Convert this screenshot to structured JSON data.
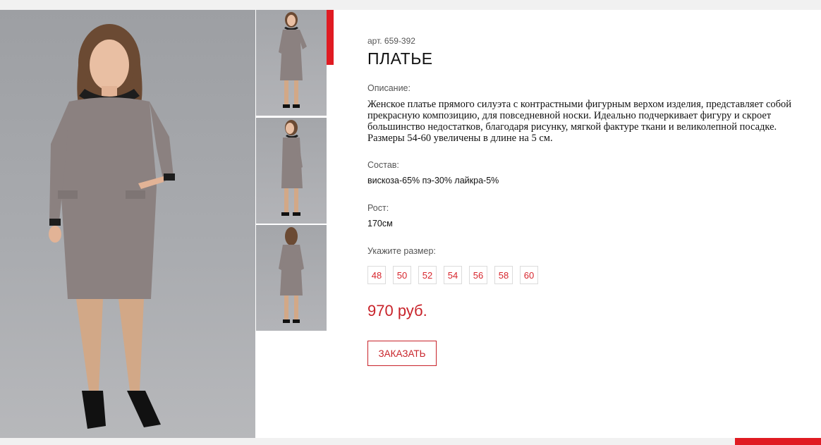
{
  "product": {
    "article": "арт. 659-392",
    "title": "ПЛАТЬЕ",
    "description_label": "Описание:",
    "description": "Женское платье прямого силуэта с контрастными фигурным верхом изделия, представляет собой прекрасную композицию, для повседневной носки. Идеально подчеркивает фигуру и скроет большинство недостатков, благодаря рисунку, мягкой фактуре ткани и великолепной посадке. Размеры 54-60 увеличены в длине на 5 см.",
    "composition_label": "Состав:",
    "composition": "вискоза-65% пэ-30% лайкра-5%",
    "height_label": "Рост:",
    "height": "170см",
    "size_label": "Укажите размер:",
    "sizes": [
      "48",
      "50",
      "52",
      "54",
      "56",
      "58",
      "60"
    ],
    "price": "970 руб.",
    "order_button": "ЗАКАЗАТЬ"
  },
  "gallery": {
    "main_photo_icon": "model-dress-front-photo",
    "thumbnails": [
      "dress-front-thumb",
      "dress-side-thumb",
      "dress-back-thumb"
    ]
  },
  "colors": {
    "accent": "#e01b22",
    "price": "#c8232a",
    "size_text": "#d7262d"
  }
}
